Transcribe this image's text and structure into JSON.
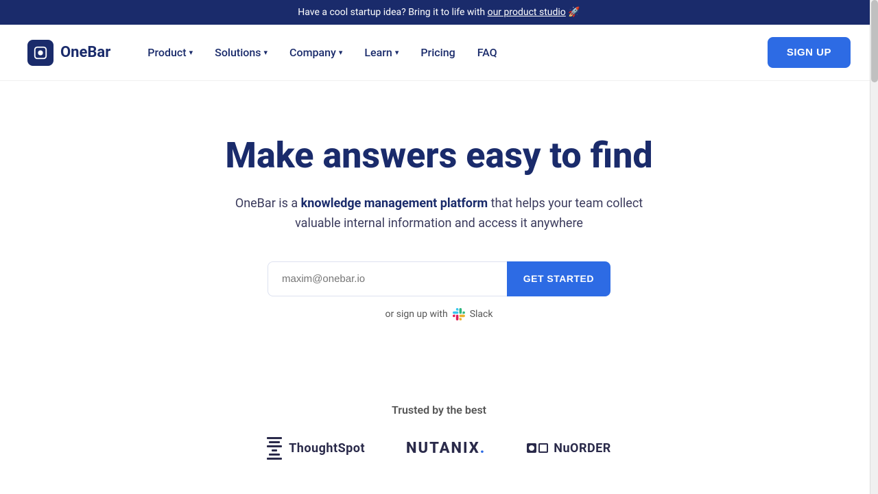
{
  "banner": {
    "text": "Have a cool startup idea? Bring it to life with",
    "link_text": "our product studio",
    "emoji": "🚀"
  },
  "logo": {
    "text": "OneBar"
  },
  "nav": {
    "items": [
      {
        "label": "Product",
        "has_dropdown": true
      },
      {
        "label": "Solutions",
        "has_dropdown": true
      },
      {
        "label": "Company",
        "has_dropdown": true
      },
      {
        "label": "Learn",
        "has_dropdown": true
      },
      {
        "label": "Pricing",
        "has_dropdown": false
      },
      {
        "label": "FAQ",
        "has_dropdown": false
      }
    ],
    "signup_label": "SIGN UP"
  },
  "hero": {
    "heading": "Make answers easy to find",
    "description_prefix": "OneBar is a ",
    "description_bold": "knowledge management platform",
    "description_suffix": " that helps your team collect valuable internal information and access it anywhere"
  },
  "email_form": {
    "placeholder": "maxim@onebar.io",
    "button_label": "GET STARTED"
  },
  "slack_signup": {
    "prefix": "or sign up with",
    "label": "Slack"
  },
  "trusted": {
    "label": "Trusted by the best",
    "companies": [
      {
        "name": "ThoughtSpot"
      },
      {
        "name": "NUTANIX"
      },
      {
        "name": "NuORDER"
      }
    ]
  }
}
